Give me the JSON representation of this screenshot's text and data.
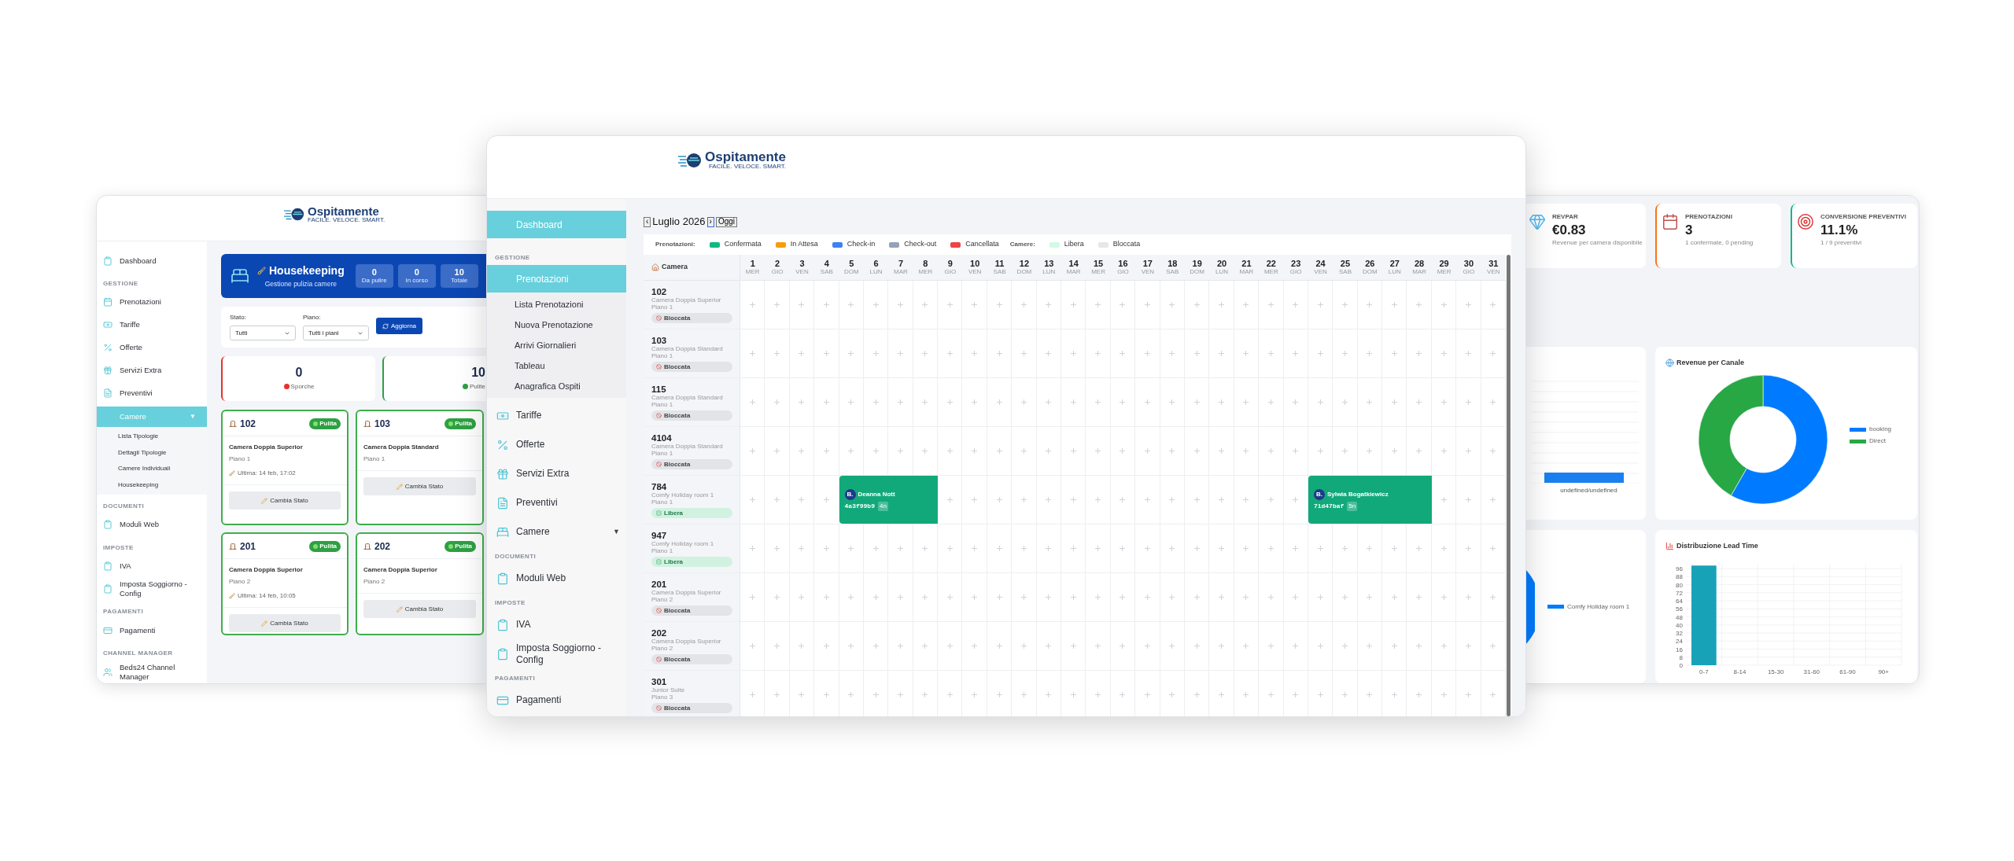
{
  "housekeeping_window": {
    "logo": {
      "name": "Ospitamente",
      "tagline": "FACILE. VELOCE. SMART."
    },
    "sidebar": [
      {
        "kind": "item",
        "label": "Dashboard",
        "selected": false
      },
      {
        "kind": "section",
        "label": "GESTIONE"
      },
      {
        "kind": "item",
        "label": "Prenotazioni",
        "selected": false
      },
      {
        "kind": "item",
        "label": "Tariffe",
        "selected": false
      },
      {
        "kind": "item",
        "label": "Offerte",
        "selected": false
      },
      {
        "kind": "item",
        "label": "Servizi Extra",
        "selected": false
      },
      {
        "kind": "item",
        "label": "Preventivi",
        "selected": false
      },
      {
        "kind": "item",
        "label": "Camere",
        "selected": true,
        "caret": "▼",
        "children": [
          {
            "label": "Lista Tipologie"
          },
          {
            "label": "Dettagli Tipologie"
          },
          {
            "label": "Camere Individuali"
          },
          {
            "label": "Housekeeping"
          }
        ]
      },
      {
        "kind": "section",
        "label": "DOCUMENTI"
      },
      {
        "kind": "item",
        "label": "Moduli Web",
        "selected": false
      },
      {
        "kind": "section",
        "label": "IMPOSTE"
      },
      {
        "kind": "item",
        "label": "IVA",
        "selected": false
      },
      {
        "kind": "item",
        "label": "Imposta Soggiorno - Config",
        "selected": false
      },
      {
        "kind": "section",
        "label": "PAGAMENTI"
      },
      {
        "kind": "item",
        "label": "Pagamenti",
        "selected": false
      },
      {
        "kind": "section",
        "label": "CHANNEL MANAGER"
      },
      {
        "kind": "item",
        "label": "Beds24 Channel Manager",
        "selected": false
      }
    ],
    "header": {
      "title": "Housekeeping",
      "subtitle": "Gestione pulizia camere",
      "stats": [
        {
          "value": "0",
          "label": "Da pulire"
        },
        {
          "value": "0",
          "label": "In corso"
        },
        {
          "value": "10",
          "label": "Totale"
        }
      ]
    },
    "filters": [
      {
        "label": "Stato:",
        "value": "Tutti"
      },
      {
        "label": "Piano:",
        "value": "Tutti i piani"
      }
    ],
    "refresh_button": "Aggiorna",
    "summary": [
      {
        "value": "0",
        "label": "Sporche",
        "color": "#e5322d"
      },
      {
        "value": "10",
        "label": "Pulite",
        "color": "#2ea043"
      }
    ],
    "rooms": [
      {
        "number": "102",
        "status": "Pulita",
        "name": "Camera Doppia Superior",
        "floor": "Piano 1",
        "last_cleaned": "Ultima: 14 feb, 17:02",
        "button": "Cambia Stato"
      },
      {
        "number": "103",
        "status": "Pulita",
        "name": "Camera Doppia Standard",
        "floor": "Piano 1",
        "button": "Cambia Stato"
      },
      {
        "number": "201",
        "status": "Pulita",
        "name": "Camera Doppia Superior",
        "floor": "Piano 2",
        "last_cleaned": "Ultima: 14 feb, 10:05",
        "button": "Cambia Stato"
      },
      {
        "number": "202",
        "status": "Pulita",
        "name": "Camera Doppia Superior",
        "floor": "Piano 2",
        "button": "Cambia Stato"
      }
    ]
  },
  "calendar_window": {
    "logo": {
      "name": "Ospitamente",
      "tagline": "FACILE. VELOCE. SMART."
    },
    "sidebar": [
      {
        "kind": "item",
        "label": "Dashboard",
        "selected": true
      },
      {
        "kind": "section",
        "label": "GESTIONE"
      },
      {
        "kind": "item",
        "label": "Prenotazioni",
        "selected": true,
        "children": [
          {
            "label": "Lista Prenotazioni"
          },
          {
            "label": "Nuova Prenotazione"
          },
          {
            "label": "Arrivi Giornalieri"
          },
          {
            "label": "Tableau"
          },
          {
            "label": "Anagrafica Ospiti"
          }
        ]
      },
      {
        "kind": "item",
        "label": "Tariffe",
        "selected": false
      },
      {
        "kind": "item",
        "label": "Offerte",
        "selected": false
      },
      {
        "kind": "item",
        "label": "Servizi Extra",
        "selected": false
      },
      {
        "kind": "item",
        "label": "Preventivi",
        "selected": false
      },
      {
        "kind": "item",
        "label": "Camere",
        "selected": false,
        "caret": "▼"
      },
      {
        "kind": "section",
        "label": "DOCUMENTI"
      },
      {
        "kind": "item",
        "label": "Moduli Web",
        "selected": false
      },
      {
        "kind": "section",
        "label": "IMPOSTE"
      },
      {
        "kind": "item",
        "label": "IVA",
        "selected": false
      },
      {
        "kind": "item",
        "label": "Imposta Soggiorno - Config",
        "selected": false
      },
      {
        "kind": "section",
        "label": "PAGAMENTI"
      },
      {
        "kind": "item",
        "label": "Pagamenti",
        "selected": false
      }
    ],
    "calendar": {
      "prev": "‹",
      "month": "Luglio 2026",
      "next": "›",
      "today_button": "Oggi",
      "bookings_legend_label": "Prenotazioni:",
      "booking_statuses": [
        {
          "label": "Confermata",
          "color": "#10b981"
        },
        {
          "label": "In Attesa",
          "color": "#f59e0b"
        },
        {
          "label": "Check-in",
          "color": "#3b82f6"
        },
        {
          "label": "Check-out",
          "color": "#94a3b8"
        },
        {
          "label": "Cancellata",
          "color": "#ef4444"
        }
      ],
      "rooms_legend_label": "Camere:",
      "room_statuses": [
        {
          "label": "Libera",
          "color": "#d1fae5"
        },
        {
          "label": "Bloccata",
          "color": "#e5e7eb"
        }
      ],
      "room_column_header": "Camera",
      "days": [
        {
          "day": "1",
          "weekday": "MER"
        },
        {
          "day": "2",
          "weekday": "GIO"
        },
        {
          "day": "3",
          "weekday": "VEN"
        },
        {
          "day": "4",
          "weekday": "SAB"
        },
        {
          "day": "5",
          "weekday": "DOM"
        },
        {
          "day": "6",
          "weekday": "LUN"
        },
        {
          "day": "7",
          "weekday": "MAR"
        },
        {
          "day": "8",
          "weekday": "MER"
        },
        {
          "day": "9",
          "weekday": "GIO"
        },
        {
          "day": "10",
          "weekday": "VEN"
        },
        {
          "day": "11",
          "weekday": "SAB"
        },
        {
          "day": "12",
          "weekday": "DOM"
        },
        {
          "day": "13",
          "weekday": "LUN"
        },
        {
          "day": "14",
          "weekday": "MAR"
        },
        {
          "day": "15",
          "weekday": "MER"
        },
        {
          "day": "16",
          "weekday": "GIO"
        },
        {
          "day": "17",
          "weekday": "VEN"
        },
        {
          "day": "18",
          "weekday": "SAB"
        },
        {
          "day": "19",
          "weekday": "DOM"
        },
        {
          "day": "20",
          "weekday": "LUN"
        },
        {
          "day": "21",
          "weekday": "MAR"
        },
        {
          "day": "22",
          "weekday": "MER"
        },
        {
          "day": "23",
          "weekday": "GIO"
        },
        {
          "day": "24",
          "weekday": "VEN"
        },
        {
          "day": "25",
          "weekday": "SAB"
        },
        {
          "day": "26",
          "weekday": "DOM"
        },
        {
          "day": "27",
          "weekday": "LUN"
        },
        {
          "day": "28",
          "weekday": "MAR"
        },
        {
          "day": "29",
          "weekday": "MER"
        },
        {
          "day": "30",
          "weekday": "GIO"
        },
        {
          "day": "31",
          "weekday": "VEN"
        }
      ],
      "rooms": [
        {
          "number": "102",
          "type": "Camera Doppia Superior",
          "floor": "Piano 1",
          "status": "Bloccata",
          "kind": "blocked"
        },
        {
          "number": "103",
          "type": "Camera Doppia Standard",
          "floor": "Piano 1",
          "status": "Bloccata",
          "kind": "blocked"
        },
        {
          "number": "115",
          "type": "Camera Doppia Standard",
          "floor": "Piano 1",
          "status": "Bloccata",
          "kind": "blocked"
        },
        {
          "number": "4104",
          "type": "Camera Doppia Standard",
          "floor": "Piano 1",
          "status": "Bloccata",
          "kind": "blocked"
        },
        {
          "number": "784",
          "type": "Comfy Holiday room 1",
          "floor": "Piano 1",
          "status": "Libera",
          "kind": "free",
          "cells": [
            {
              "kind": "empty"
            },
            {
              "kind": "empty"
            },
            {
              "kind": "empty"
            },
            {
              "kind": "empty"
            },
            {
              "kind": "booking",
              "color": "#12a97a",
              "initial": "B.",
              "guest": "Deanna Nott",
              "code": "4a3f99b9",
              "nights": "4n"
            },
            {
              "kind": "empty"
            },
            {
              "kind": "empty"
            },
            {
              "kind": "empty"
            },
            {
              "kind": "empty"
            },
            {
              "kind": "empty"
            },
            {
              "kind": "empty"
            },
            {
              "kind": "empty"
            },
            {
              "kind": "empty"
            },
            {
              "kind": "empty"
            },
            {
              "kind": "empty"
            },
            {
              "kind": "empty"
            },
            {
              "kind": "empty"
            },
            {
              "kind": "empty"
            },
            {
              "kind": "empty"
            },
            {
              "kind": "empty"
            },
            {
              "kind": "booking",
              "color": "#12a97a",
              "initial": "B.",
              "guest": "Sylwia Bogatkiewicz",
              "code": "71d47baf",
              "nights": "5n"
            },
            {
              "kind": "empty"
            },
            {
              "kind": "empty"
            },
            {
              "kind": "empty"
            }
          ]
        },
        {
          "number": "947",
          "type": "Comfy Holiday room 1",
          "floor": "Piano 1",
          "status": "Libera",
          "kind": "free"
        },
        {
          "number": "201",
          "type": "Camera Doppia Superior",
          "floor": "Piano 2",
          "status": "Bloccata",
          "kind": "blocked"
        },
        {
          "number": "202",
          "type": "Camera Doppia Superior",
          "floor": "Piano 2",
          "status": "Bloccata",
          "kind": "blocked"
        },
        {
          "number": "301",
          "type": "Junior Suite",
          "floor": "Piano 3",
          "status": "Bloccata",
          "kind": "blocked"
        }
      ]
    }
  },
  "stats_window": {
    "kpis": [
      {
        "label": "REVPAR",
        "value": "€0.83",
        "note": "Revenue per camera disponibile"
      },
      {
        "label": "PRENOTAZIONI",
        "value": "3",
        "note": "1 confermate, 0 pending",
        "color": "#f97316"
      },
      {
        "label": "CONVERSIONE PREVENTIVI",
        "value": "11.1%",
        "note": "1 / 9 preventivi",
        "color": "#10b981"
      }
    ],
    "occupancy_chart": {
      "axis_label": "undefined/undefined"
    },
    "channel_revenue": {
      "title": "Revenue per Canale",
      "legend": [
        {
          "label": "booking",
          "color": "#007bff"
        },
        {
          "label": "Direct",
          "color": "#28a745"
        }
      ]
    },
    "room_revenue": {
      "legend": [
        {
          "label": "Comfy Holiday room 1",
          "color": "#007bff"
        }
      ]
    },
    "lead_time": {
      "title": "Distribuzione Lead Time",
      "chart_data": {
        "type": "bar",
        "categories": [
          "0-7",
          "8-14",
          "15-30",
          "31-60",
          "61-90",
          "90+"
        ],
        "values": [
          99,
          0,
          0,
          0,
          0,
          0
        ],
        "ylim": [
          0,
          100
        ],
        "grid": true,
        "yticks": [
          0,
          8,
          16,
          24,
          32,
          40,
          48,
          56,
          64,
          72,
          80,
          88,
          96
        ]
      }
    }
  }
}
